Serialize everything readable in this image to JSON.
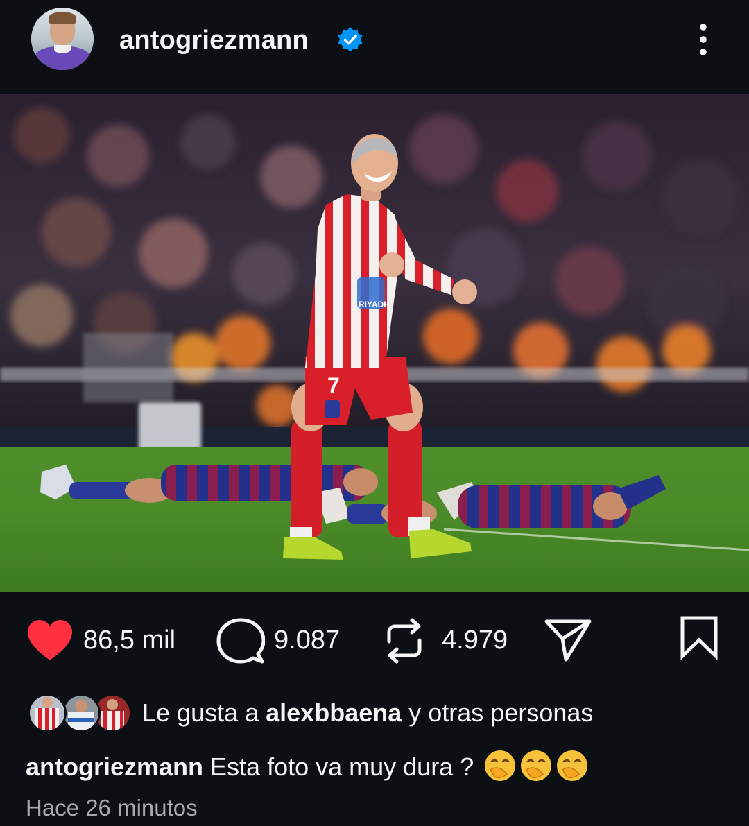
{
  "post": {
    "username": "antogriezmann",
    "verified": true,
    "avatar_icon": "profile-avatar",
    "more_icon": "more-vertical-icon"
  },
  "photo": {
    "jersey_number": "7",
    "sponsor_text": "RIYADH"
  },
  "actions": {
    "likes_count": "86,5 mil",
    "comments_count": "9.087",
    "reposts_count": "4.979",
    "like_color": "#ff3040",
    "icons": [
      "heart-icon",
      "comment-icon",
      "repost-icon",
      "share-icon",
      "bookmark-icon"
    ]
  },
  "liked_by": {
    "prefix": "Le gusta a ",
    "user": "alexbbaena",
    "suffix": " y otras personas"
  },
  "caption": {
    "username": "antogriezmann",
    "text": " Esta foto va muy dura ?",
    "emoji": "🤭🤭🤭"
  },
  "timestamp": "Hace 26 minutos"
}
